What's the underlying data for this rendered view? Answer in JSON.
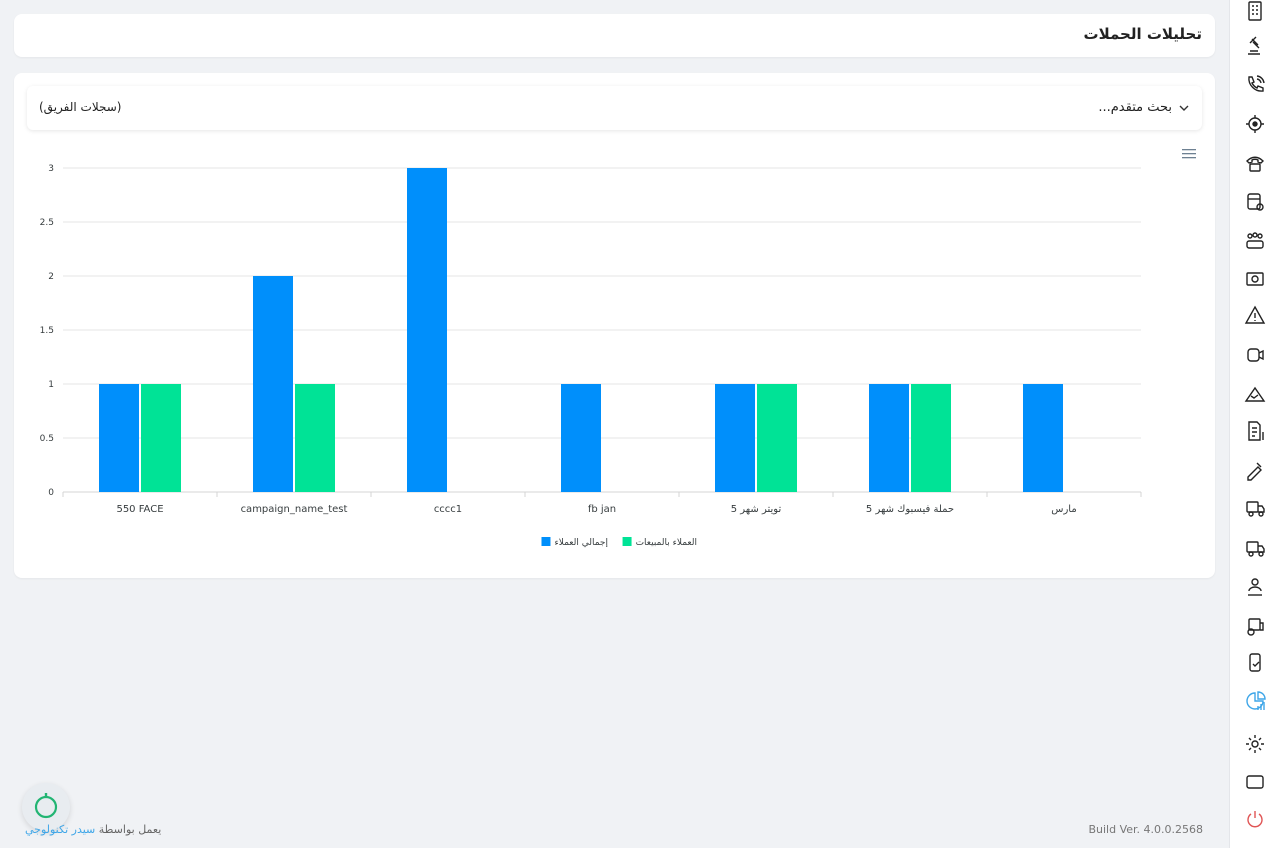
{
  "page": {
    "title": "تحليلات الحملات"
  },
  "filter": {
    "advanced_search": "بحث متقدم...",
    "team_records": "(سجلات الفريق)"
  },
  "footer": {
    "powered_by": "يعمل بواسطة",
    "brand": "سيدر تكنولوجي",
    "build": "Build Ver. 4.0.0.2568"
  },
  "sidebar": {
    "icons": [
      "building-icon",
      "gavel-icon",
      "phone-call-icon",
      "target-icon",
      "telephone-icon",
      "database-settings-icon",
      "team-icon",
      "money-icon",
      "warning-icon",
      "video-icon",
      "mountain-icon",
      "invoice-icon",
      "sign-icon",
      "truck-icon",
      "truck-box-icon",
      "user-route-icon",
      "truck-add-icon",
      "hand-phone-icon",
      "chart-pie-icon",
      "gear-icon",
      "rectangle-icon",
      "power-icon"
    ],
    "active": "chart-pie-icon"
  },
  "colors": {
    "series_total": "#008ffb",
    "series_sales": "#00e396",
    "active_icon": "#3ea6e8",
    "power_icon": "#e05555"
  },
  "chart_data": {
    "type": "bar",
    "categories": [
      "550 FACE",
      "campaign_name_test",
      "cccc1",
      "fb jan",
      "تويتر شهر 5",
      "حملة فيسبوك شهر 5",
      "مارس"
    ],
    "series": [
      {
        "name": "إجمالي العملاء",
        "values": [
          1,
          2,
          3,
          1,
          1,
          1,
          1
        ]
      },
      {
        "name": "العملاء بالمبيعات",
        "values": [
          1,
          1,
          0,
          0,
          1,
          1,
          0
        ]
      }
    ],
    "y_ticks": [
      "0",
      "0.5",
      "1",
      "1.5",
      "2",
      "2.5",
      "3"
    ],
    "ylim": [
      0,
      3
    ],
    "grid": true,
    "legend_position": "bottom-center"
  }
}
